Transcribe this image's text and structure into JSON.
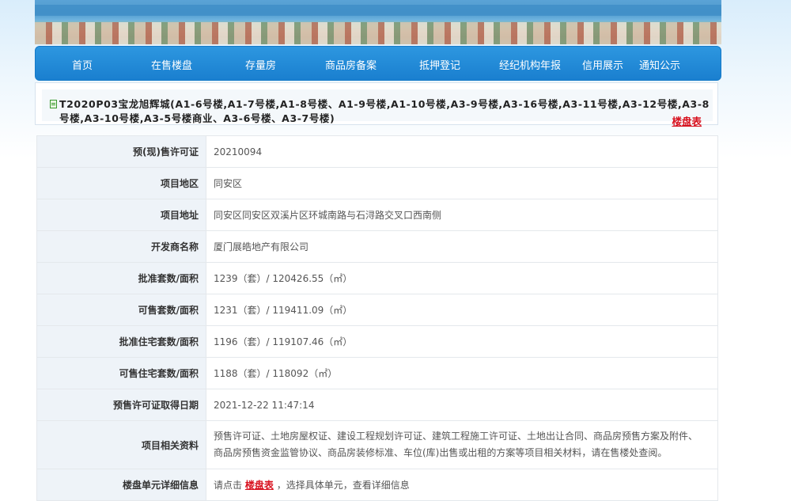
{
  "nav": {
    "items": [
      "首页",
      "在售楼盘",
      "存量房",
      "商品房备案",
      "抵押登记",
      "经纪机构年报",
      "信用展示",
      "通知公示"
    ]
  },
  "project": {
    "title": "T2020P03宝龙旭辉城(A1-6号楼,A1-7号楼,A1-8号楼、A1-9号楼,A1-10号楼,A3-9号楼,A3-16号楼,A3-11号楼,A3-12号楼,A3-8号楼,A3-10号楼,A3-5号楼商业、A3-6号楼、A3-7号楼)",
    "floor_plan_link": "楼盘表"
  },
  "details": [
    {
      "label": "预(现)售许可证",
      "value": "20210094"
    },
    {
      "label": "项目地区",
      "value": "同安区"
    },
    {
      "label": "项目地址",
      "value": "同安区同安区双溪片区环城南路与石浔路交叉口西南侧"
    },
    {
      "label": "开发商名称",
      "value": "厦门展皓地产有限公司"
    },
    {
      "label": "批准套数/面积",
      "value": "1239（套）/ 120426.55（㎡）"
    },
    {
      "label": "可售套数/面积",
      "value": "1231（套）/ 119411.09（㎡）"
    },
    {
      "label": "批准住宅套数/面积",
      "value": "1196（套）/ 119107.46（㎡）"
    },
    {
      "label": "可售住宅套数/面积",
      "value": "1188（套）/ 118092（㎡）"
    },
    {
      "label": "预售许可证取得日期",
      "value": "2021-12-22 11:47:14"
    },
    {
      "label": "项目相关资料",
      "value": "预售许可证、土地房屋权证、建设工程规划许可证、建筑工程施工许可证、土地出让合同、商品房预售方案及附件、商品房预售资金监管协议、商品房装修标准、车位(库)出售或出租的方案等项目相关材料，请在售楼处查阅。"
    },
    {
      "label": "楼盘单元详细信息",
      "value_prefix": "请点击",
      "value_link": "楼盘表",
      "value_suffix": "，选择具体单元，查看详细信息"
    }
  ]
}
